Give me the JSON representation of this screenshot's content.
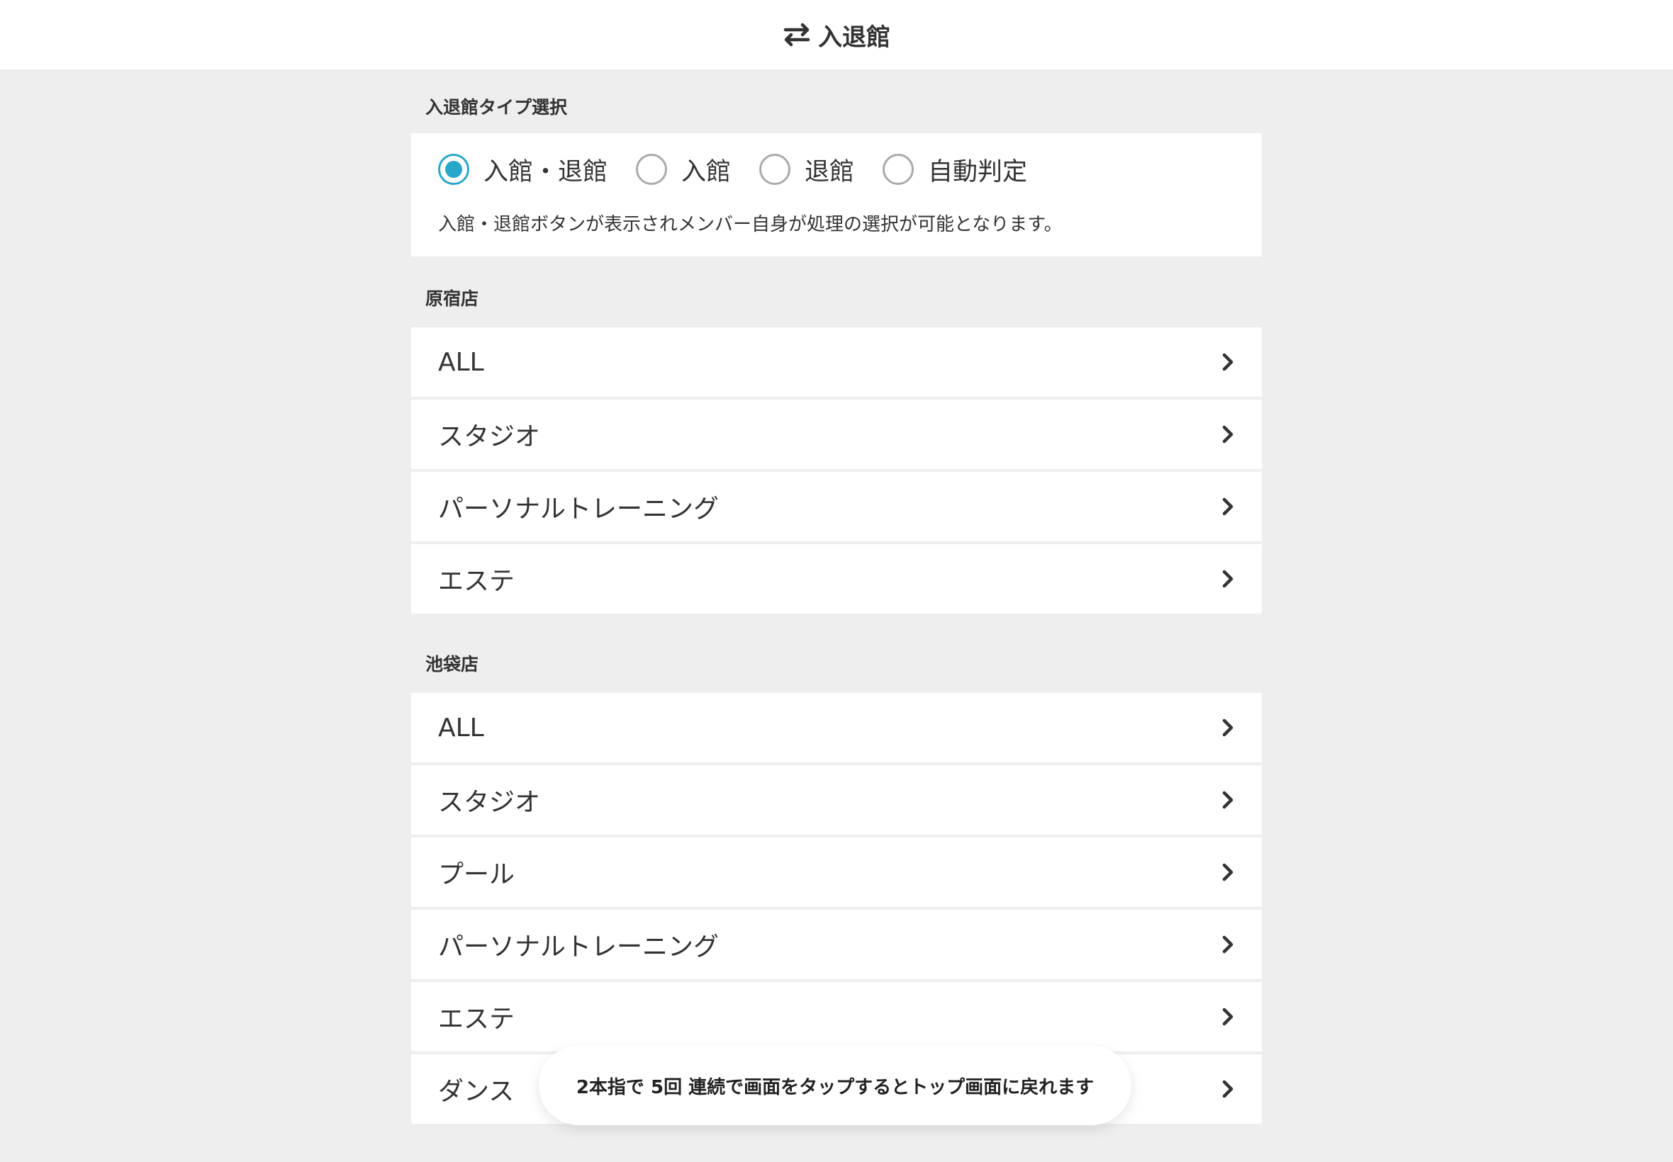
{
  "header": {
    "title": "入退館",
    "icon": "swap-arrows-icon"
  },
  "type_selection": {
    "title": "入退館タイプ選択",
    "options": [
      {
        "label": "入館・退館",
        "checked": true
      },
      {
        "label": "入館",
        "checked": false
      },
      {
        "label": "退館",
        "checked": false
      },
      {
        "label": "自動判定",
        "checked": false
      }
    ],
    "description": "入館・退館ボタンが表示されメンバー自身が処理の選択が可能となります。"
  },
  "stores": [
    {
      "name": "原宿店",
      "items": [
        "ALL",
        "スタジオ",
        "パーソナルトレーニング",
        "エステ"
      ]
    },
    {
      "name": "池袋店",
      "items": [
        "ALL",
        "スタジオ",
        "プール",
        "パーソナルトレーニング",
        "エステ",
        "ダンス"
      ]
    }
  ],
  "toast": {
    "text": "2本指で 5回 連続で画面をタップするとトップ画面に戻れます"
  },
  "colors": {
    "accent": "#29a7c9",
    "background": "#eeeeee",
    "card": "#ffffff",
    "text": "#333333"
  }
}
